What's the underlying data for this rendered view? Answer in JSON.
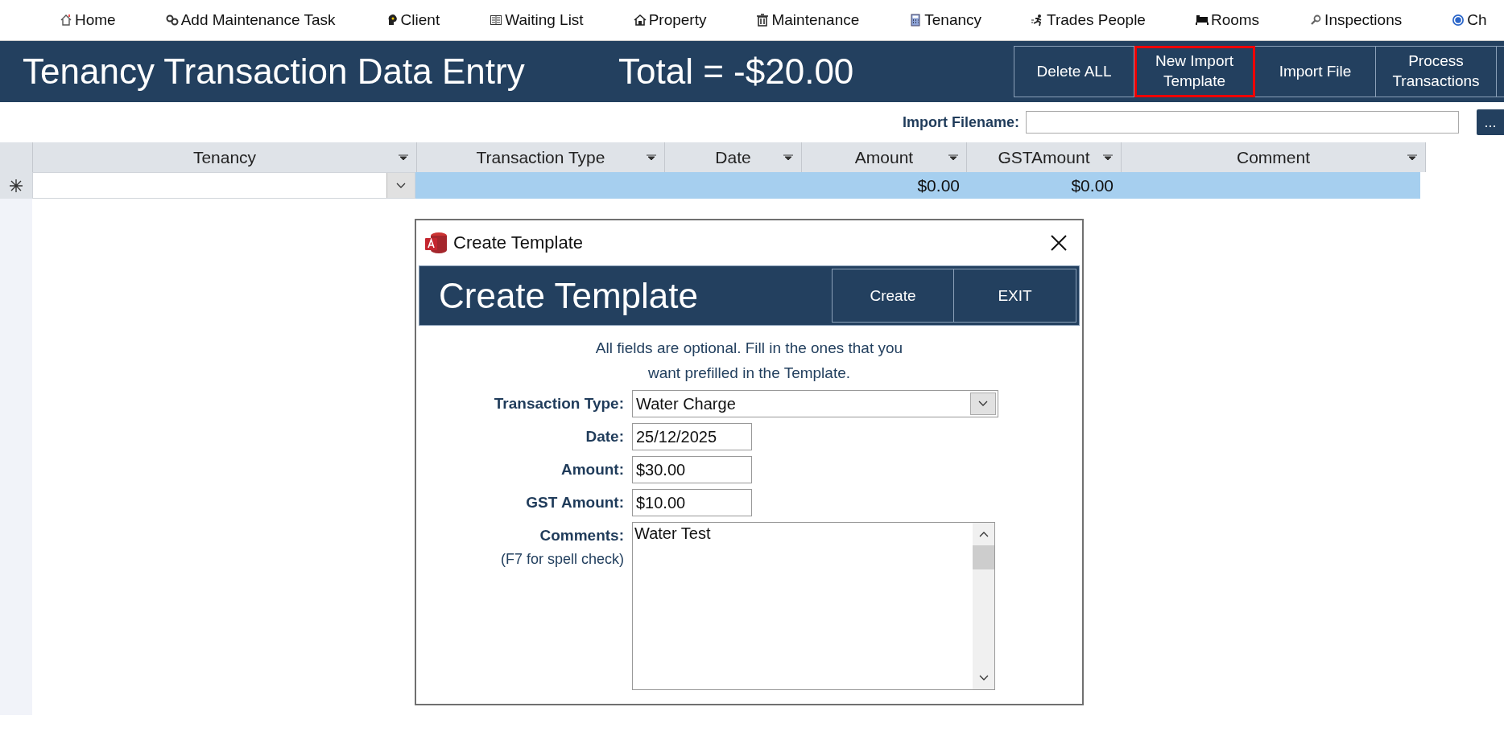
{
  "nav": {
    "items": [
      {
        "label": "Home"
      },
      {
        "label": "Add Maintenance Task"
      },
      {
        "label": "Client"
      },
      {
        "label": "Waiting List"
      },
      {
        "label": "Property"
      },
      {
        "label": "Maintenance"
      },
      {
        "label": "Tenancy"
      },
      {
        "label": "Trades People"
      },
      {
        "label": "Rooms"
      },
      {
        "label": "Inspections"
      },
      {
        "label": "Ch"
      }
    ]
  },
  "header": {
    "title": "Tenancy Transaction Data Entry",
    "total": "Total = -$20.00",
    "buttons": [
      {
        "label": "Delete ALL",
        "highlighted": false
      },
      {
        "label": "New Import Template",
        "highlighted": true
      },
      {
        "label": "Import File",
        "highlighted": false
      },
      {
        "label": "Process Transactions",
        "highlighted": false
      }
    ]
  },
  "import": {
    "label": "Import Filename:",
    "browse": "..."
  },
  "table": {
    "columns": [
      {
        "label": "Tenancy"
      },
      {
        "label": "Transaction Type"
      },
      {
        "label": "Date"
      },
      {
        "label": "Amount"
      },
      {
        "label": "GSTAmount"
      },
      {
        "label": "Comment"
      }
    ],
    "new_row": {
      "amount": "$0.00",
      "gst_amount": "$0.00"
    }
  },
  "dialog": {
    "title": "Create Template",
    "heading": "Create Template",
    "buttons": [
      {
        "label": "Create"
      },
      {
        "label": "EXIT"
      }
    ],
    "instructions": "All fields are optional. Fill in the ones that you\nwant prefilled in the Template.",
    "fields": [
      {
        "label": "Transaction Type:",
        "kind": "combo",
        "value": "Water Charge"
      },
      {
        "label": "Date:",
        "kind": "text",
        "value": "25/12/2025"
      },
      {
        "label": "Amount:",
        "kind": "text",
        "value": "$30.00"
      },
      {
        "label": "GST Amount:",
        "kind": "text",
        "value": "$10.00"
      },
      {
        "label": "Comments:",
        "kind": "memo",
        "value": "Water Test",
        "note": "(F7 for spell check)"
      }
    ]
  }
}
